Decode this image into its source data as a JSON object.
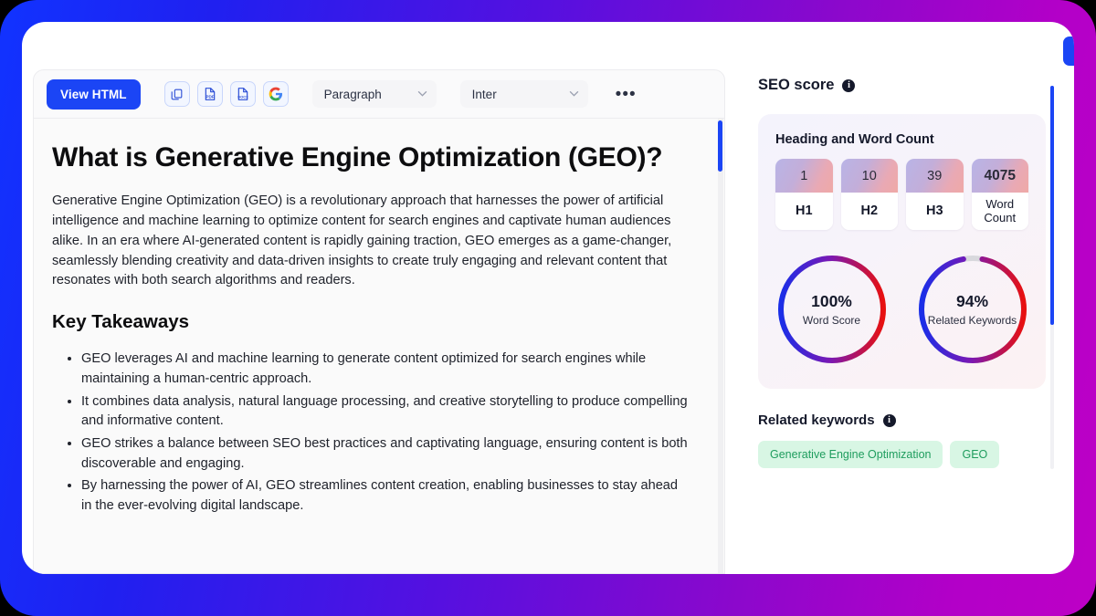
{
  "toolbar": {
    "view_html_label": "View HTML",
    "icons": [
      {
        "name": "copy-icon",
        "label": "Copy"
      },
      {
        "name": "pdf-export-icon",
        "label": "PDF"
      },
      {
        "name": "docx-export-icon",
        "label": "DOCX"
      },
      {
        "name": "google-docs-export-icon",
        "label": "Google"
      }
    ],
    "style_select": {
      "value": "Paragraph",
      "chevron": "⌄"
    },
    "font_select": {
      "value": "Inter",
      "chevron": "⌄"
    },
    "more_label": "•••"
  },
  "document": {
    "title": "What is Generative Engine Optimization (GEO)?",
    "lead": "Generative Engine Optimization (GEO) is a revolutionary approach that harnesses the power of artificial intelligence and machine learning to optimize content for search engines and captivate human audiences alike. In an era where AI-generated content is rapidly gaining traction, GEO emerges as a game-changer, seamlessly blending creativity and data-driven insights to create truly engaging and relevant content that resonates with both search algorithms and readers.",
    "section_heading": "Key Takeaways",
    "bullets": [
      "GEO leverages AI and machine learning to generate content optimized for search engines while maintaining a human-centric approach.",
      "It combines data analysis, natural language processing, and creative storytelling to produce compelling and informative content.",
      "GEO strikes a balance between SEO best practices and captivating language, ensuring content is both discoverable and engaging.",
      "By harnessing the power of AI, GEO streamlines content creation, enabling businesses to stay ahead in the ever-evolving digital landscape."
    ]
  },
  "panel": {
    "title": "SEO score",
    "info_glyph": "i",
    "card_title": "Heading and Word Count",
    "counts": [
      {
        "value": "1",
        "label": "H1",
        "bold_value": false,
        "small_label": false
      },
      {
        "value": "10",
        "label": "H2",
        "bold_value": false,
        "small_label": false
      },
      {
        "value": "39",
        "label": "H3",
        "bold_value": false,
        "small_label": false
      },
      {
        "value": "4075",
        "label": "Word Count",
        "bold_value": true,
        "small_label": true
      }
    ],
    "keywords_title": "Related keywords",
    "keywords": [
      "Generative Engine Optimization",
      "GEO"
    ],
    "next_button_label": "→"
  },
  "chart_data": [
    {
      "type": "pie",
      "title": "Word Score",
      "value": 100,
      "display": "100%",
      "max": 100,
      "style": "donut",
      "gradient": [
        "#1a2ee8",
        "#7a18b4",
        "#e8100f"
      ],
      "track_color": "#d8d8dd"
    },
    {
      "type": "pie",
      "title": "Related Keywords",
      "value": 94,
      "display": "94%",
      "max": 100,
      "style": "donut",
      "gradient": [
        "#1a2ee8",
        "#7a18b4",
        "#e8100f"
      ],
      "track_color": "#d8d8dd"
    }
  ],
  "colors": {
    "accent": "#1b45f5",
    "frame_start": "#1133ff",
    "frame_end": "#bd00c6",
    "keyword_pill_bg": "#d8f6e4",
    "keyword_pill_text": "#1f9d5e"
  }
}
